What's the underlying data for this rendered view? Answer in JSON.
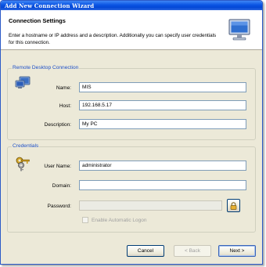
{
  "window": {
    "title": "Add New Connection Wizard"
  },
  "header": {
    "title": "Connection Settings",
    "description": "Enter a hostname or IP address and a description. Additionally you can specify user credentials for this connection."
  },
  "rdc_group": {
    "label": "Remote Desktop Connection",
    "name_label": "Name:",
    "name_value": "MIS",
    "host_label": "Host:",
    "host_value": "192.168.5.17",
    "description_label": "Description:",
    "description_value": "My PC"
  },
  "credentials_group": {
    "label": "Credentials",
    "username_label": "User Name:",
    "username_value": "administrator",
    "domain_label": "Domain:",
    "domain_value": "",
    "password_label": "Password:",
    "password_value": "",
    "auto_logon_label": "Enable Automatic Logon"
  },
  "buttons": {
    "cancel": "Cancel",
    "back": "< Back",
    "next": "Next >"
  },
  "icons": {
    "header": "monitor-icon",
    "rdc": "remote-desktop-icon",
    "credentials": "keys-icon",
    "password_button": "lock-icon"
  },
  "colors": {
    "title_bar": "#0a54e3",
    "group_label": "#1e50c8",
    "window_bg": "#ece9d8"
  }
}
